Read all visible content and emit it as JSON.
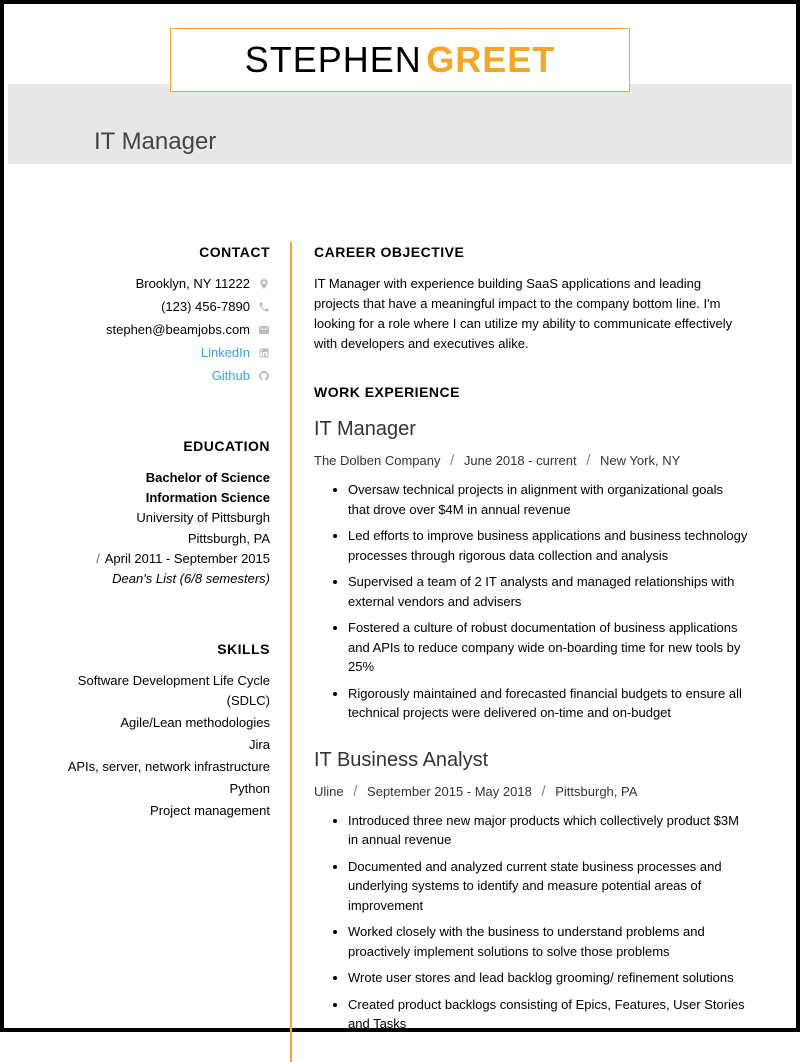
{
  "name": {
    "first": "STEPHEN",
    "last": "GREET"
  },
  "title": "IT Manager",
  "contact": {
    "heading": "CONTACT",
    "location": "Brooklyn, NY 11222",
    "phone": "(123) 456-7890",
    "email": "stephen@beamjobs.com",
    "linkedin": "LinkedIn",
    "github": "Github"
  },
  "education": {
    "heading": "EDUCATION",
    "degree": "Bachelor of Science",
    "field": "Information Science",
    "school": "University of Pittsburgh",
    "school_loc": "Pittsburgh, PA",
    "dates": "April 2011 - September 2015",
    "honor": "Dean's List (6/8 semesters)"
  },
  "skills": {
    "heading": "SKILLS",
    "items": [
      "Software Development Life Cycle (SDLC)",
      "Agile/Lean methodologies",
      "Jira",
      "APIs, server, network infrastructure",
      "Python",
      "Project management"
    ]
  },
  "objective": {
    "heading": "CAREER OBJECTIVE",
    "text": "IT Manager with experience building SaaS applications and leading projects that have a meaningful impact to the company bottom line. I'm looking for a role where I can utilize my ability to communicate effectively with developers and executives alike."
  },
  "experience": {
    "heading": "WORK EXPERIENCE",
    "jobs": [
      {
        "role": "IT Manager",
        "company": "The Dolben Company",
        "dates": "June 2018 - current",
        "location": "New York, NY",
        "bullets": [
          "Oversaw technical projects in alignment with organizational goals that drove over $4M in annual revenue",
          "Led efforts to improve business applications and business technology processes through rigorous data collection and analysis",
          "Supervised a team of 2 IT analysts and managed relationships with external vendors and advisers",
          "Fostered a culture of robust documentation of business applications and APIs to reduce company wide on-boarding time for new tools by 25%",
          "Rigorously maintained and forecasted financial budgets to ensure all technical projects were delivered on-time and on-budget"
        ]
      },
      {
        "role": "IT Business Analyst",
        "company": "Uline",
        "dates": "September 2015 - May 2018",
        "location": "Pittsburgh, PA",
        "bullets": [
          "Introduced three new major products which collectively product $3M in annual revenue",
          "Documented and analyzed current state business processes and underlying systems to identify and measure potential areas of improvement",
          "Worked closely with the business to understand problems and proactively implement solutions to solve those problems",
          "Wrote user stores and lead backlog grooming/ refinement solutions",
          "Created product backlogs consisting of Epics, Features, User Stories and Tasks"
        ]
      }
    ]
  }
}
